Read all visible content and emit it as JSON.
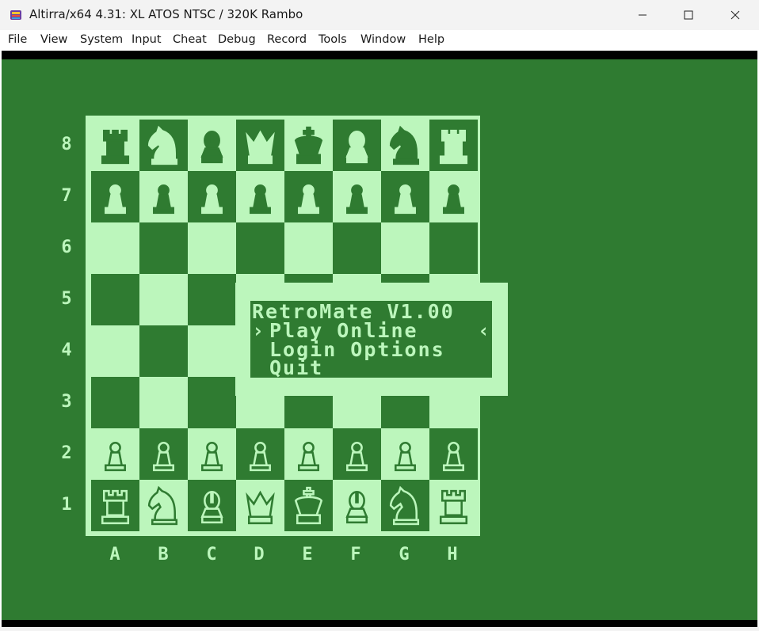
{
  "window": {
    "title": "Altirra/x64 4.31: XL ATOS NTSC / 320K Rambo",
    "controls": [
      "minimize-icon",
      "maximize-icon",
      "close-icon"
    ]
  },
  "menubar": {
    "items": [
      "File",
      "View",
      "System",
      "Input",
      "Cheat",
      "Debug",
      "Record",
      "Tools",
      "Window",
      "Help"
    ]
  },
  "colors": {
    "screen_green": "#2f7b31",
    "screen_light": "#bcf6bc",
    "border": "#000000"
  },
  "board": {
    "ranks": [
      "8",
      "7",
      "6",
      "5",
      "4",
      "3",
      "2",
      "1"
    ],
    "files": [
      "A",
      "B",
      "C",
      "D",
      "E",
      "F",
      "G",
      "H"
    ],
    "position": [
      [
        "r",
        "n",
        "b",
        "q",
        "k",
        "b",
        "n",
        "r"
      ],
      [
        "p",
        "p",
        "p",
        "p",
        "p",
        "p",
        "p",
        "p"
      ],
      [
        "",
        "",
        "",
        "",
        "",
        "",
        "",
        ""
      ],
      [
        "",
        "",
        "",
        "",
        "",
        "",
        "",
        ""
      ],
      [
        "",
        "",
        "",
        "",
        "",
        "",
        "",
        ""
      ],
      [
        "",
        "",
        "",
        "",
        "",
        "",
        "",
        ""
      ],
      [
        "P",
        "P",
        "P",
        "P",
        "P",
        "P",
        "P",
        "P"
      ],
      [
        "R",
        "N",
        "B",
        "Q",
        "K",
        "B",
        "N",
        "R"
      ]
    ]
  },
  "menu": {
    "title": "RetroMate V1.00",
    "items": [
      "Play Online",
      "Login Options",
      "Quit"
    ],
    "selected_index": 0,
    "cursor_left": "›",
    "cursor_right": "‹"
  }
}
